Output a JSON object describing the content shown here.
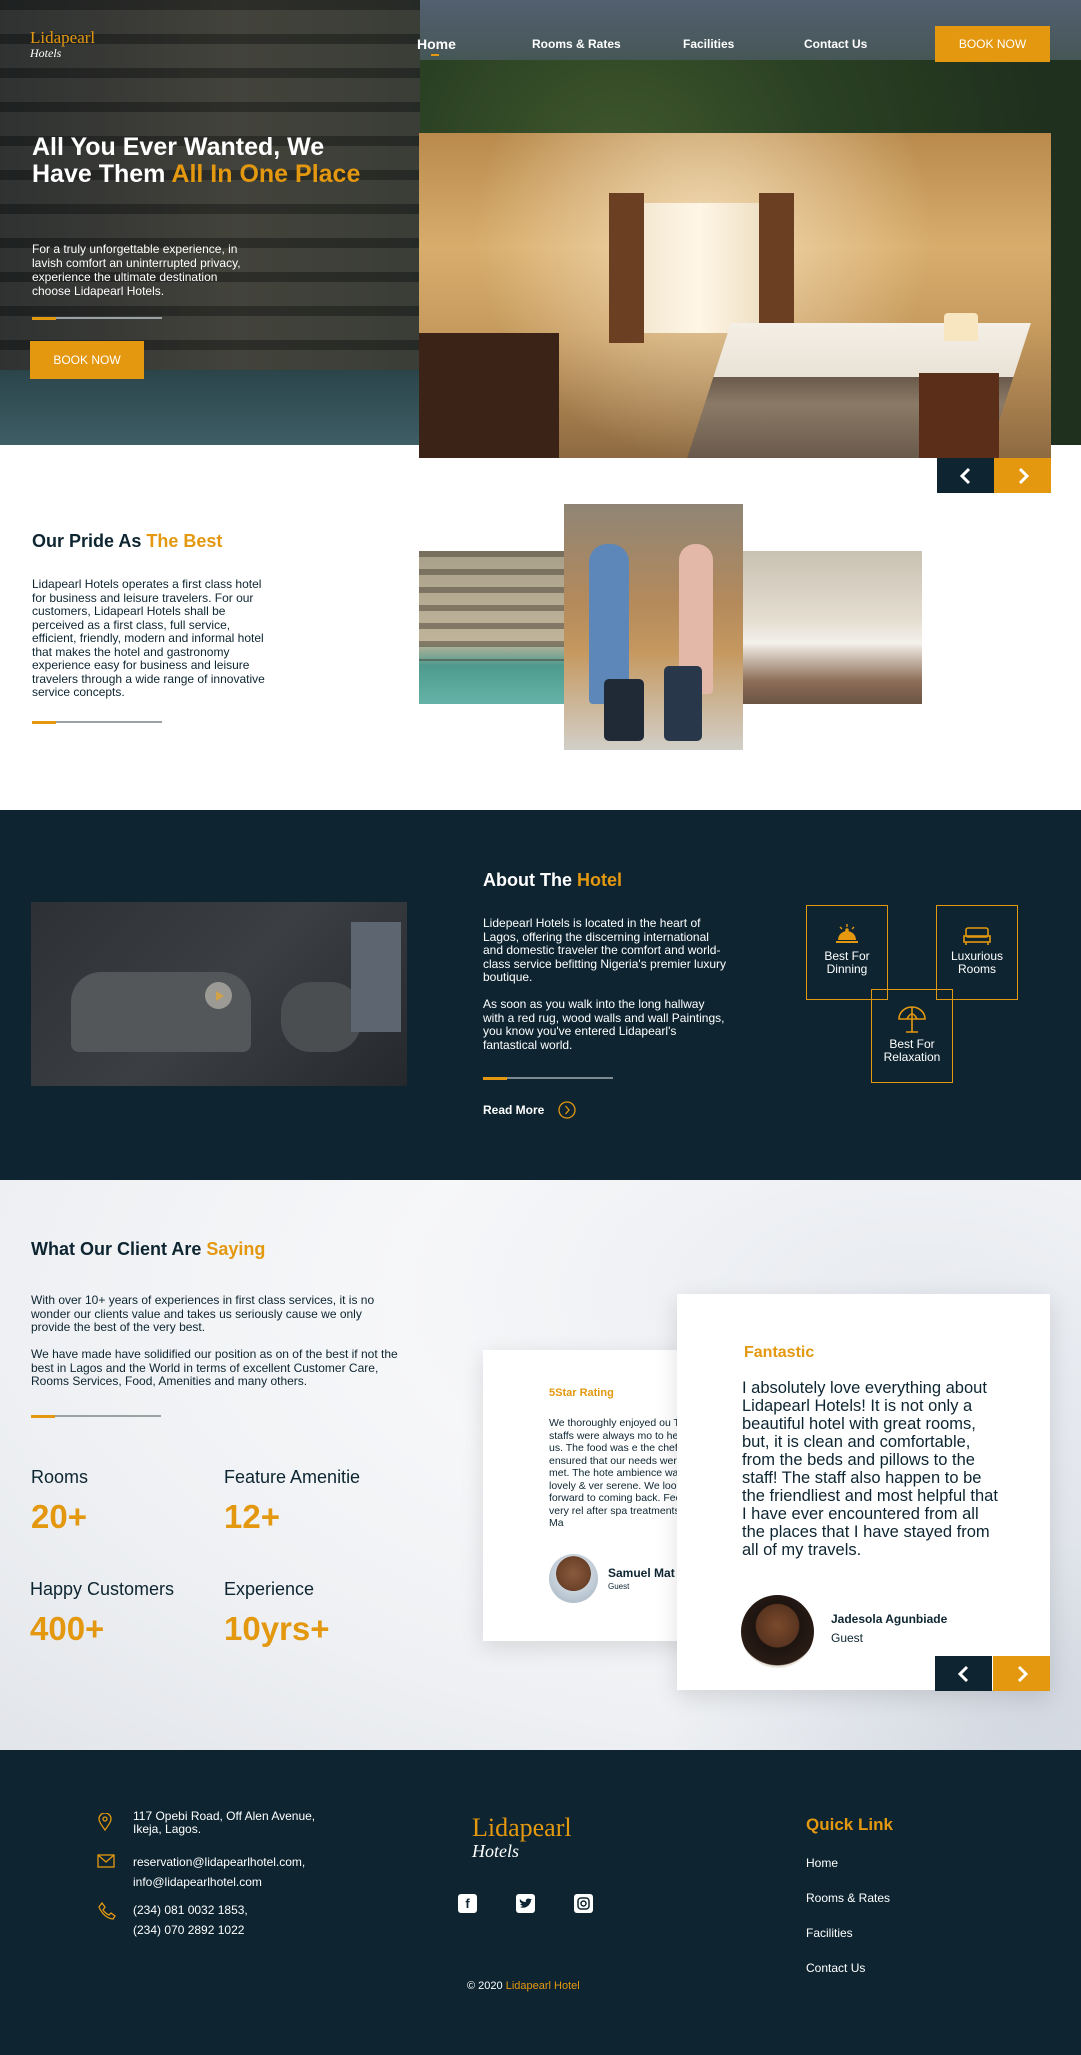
{
  "brand": {
    "name": "Lidapearl",
    "sub": "Hotels"
  },
  "nav": {
    "items": [
      "Home",
      "Rooms & Rates",
      "Facilities",
      "Contact Us"
    ],
    "active": "Home",
    "book_now": "BOOK NOW"
  },
  "hero": {
    "title_a": "All You Ever Wanted, We Have Them ",
    "title_b": "All In One Place",
    "desc": "For a truly unforgettable experience, in lavish comfort an uninterrupted privacy, experience the ultimate destination choose Lidapearl Hotels.",
    "cta": "BOOK NOW"
  },
  "pride": {
    "title_a": "Our Pride As ",
    "title_b": "The Best",
    "body": "Lidapearl Hotels operates a first class hotel for business and leisure travelers. For our customers, Lidapearl Hotels shall be perceived as a first class, full service, efficient, friendly, modern and informal hotel that makes the hotel and gastronomy experience easy for business and leisure travelers through a wide range of innovative service concepts."
  },
  "about": {
    "title_a": "About The ",
    "title_b": "Hotel",
    "p1": "Lidepearl Hotels is located in the heart of Lagos, offering the discerning international and domestic traveler the comfort and world-class service befitting Nigeria's premier luxury boutique.",
    "p2": "As soon as you walk into the long hallway with a red rug, wood walls and wall Paintings, you know you've entered Lidapearl's fantastical world.",
    "read_more": "Read More",
    "features": [
      {
        "label": "Best For Dinning",
        "icon": "dining-icon"
      },
      {
        "label": "Luxurious Rooms",
        "icon": "bed-icon"
      },
      {
        "label": "Best For Relaxation",
        "icon": "umbrella-icon"
      }
    ]
  },
  "clients": {
    "title_a": "What Our Client Are ",
    "title_b": "Saying",
    "p1": "With over 10+ years of experiences in first class services, it is no wonder our clients value and takes us seriously cause we only provide the best of the very best.",
    "p2": "We have made have solidified our position as on of the best if not the best in Lagos and the World in terms of excellent Customer Care, Rooms Services, Food, Amenities and many others.",
    "stats": [
      {
        "label": "Rooms",
        "value": "20+"
      },
      {
        "label": "Feature Amenitie",
        "value": "12+"
      },
      {
        "label": "Happy Customers",
        "value": "400+"
      },
      {
        "label": "Experience",
        "value": "10yrs+"
      }
    ],
    "back_card": {
      "heading": "5Star Rating",
      "text": "We thoroughly enjoyed ou The staffs were always mo to help us. The food was e the chef ensured that our needs were met. The hote ambience was lovely & ver serene. We look forward to coming back. Feel very rel after spa treatments at Ma",
      "name": "Samuel Mat",
      "role": "Guest"
    },
    "front_card": {
      "heading": "Fantastic",
      "text": "I absolutely love everything about Lidapearl Hotels! It is not only a beautiful hotel with great rooms, but, it is clean and comfortable, from the beds and pillows to the staff! The staff also happen to be the friendliest and most helpful that I have ever encountered from all the places that I have stayed from all of my travels.",
      "name": "Jadesola Agunbiade",
      "role": "Guest"
    }
  },
  "footer": {
    "address": "117 Opebi Road, Off Alen Avenue, Ikeja, Lagos.",
    "email1": "reservation@lidapearlhotel.com,",
    "email2": "info@lidapearlhotel.com",
    "phone1": "(234) 081 0032 1853,",
    "phone2": "(234) 070 2892 1022",
    "quick_title": "Quick Link",
    "links": [
      "Home",
      "Rooms & Rates",
      "Facilities",
      "Contact Us"
    ],
    "copyright": "© 2020 ",
    "copyright_brand": "Lidapearl Hotel"
  },
  "colors": {
    "accent": "#e3980f",
    "dark": "#0e2531"
  }
}
